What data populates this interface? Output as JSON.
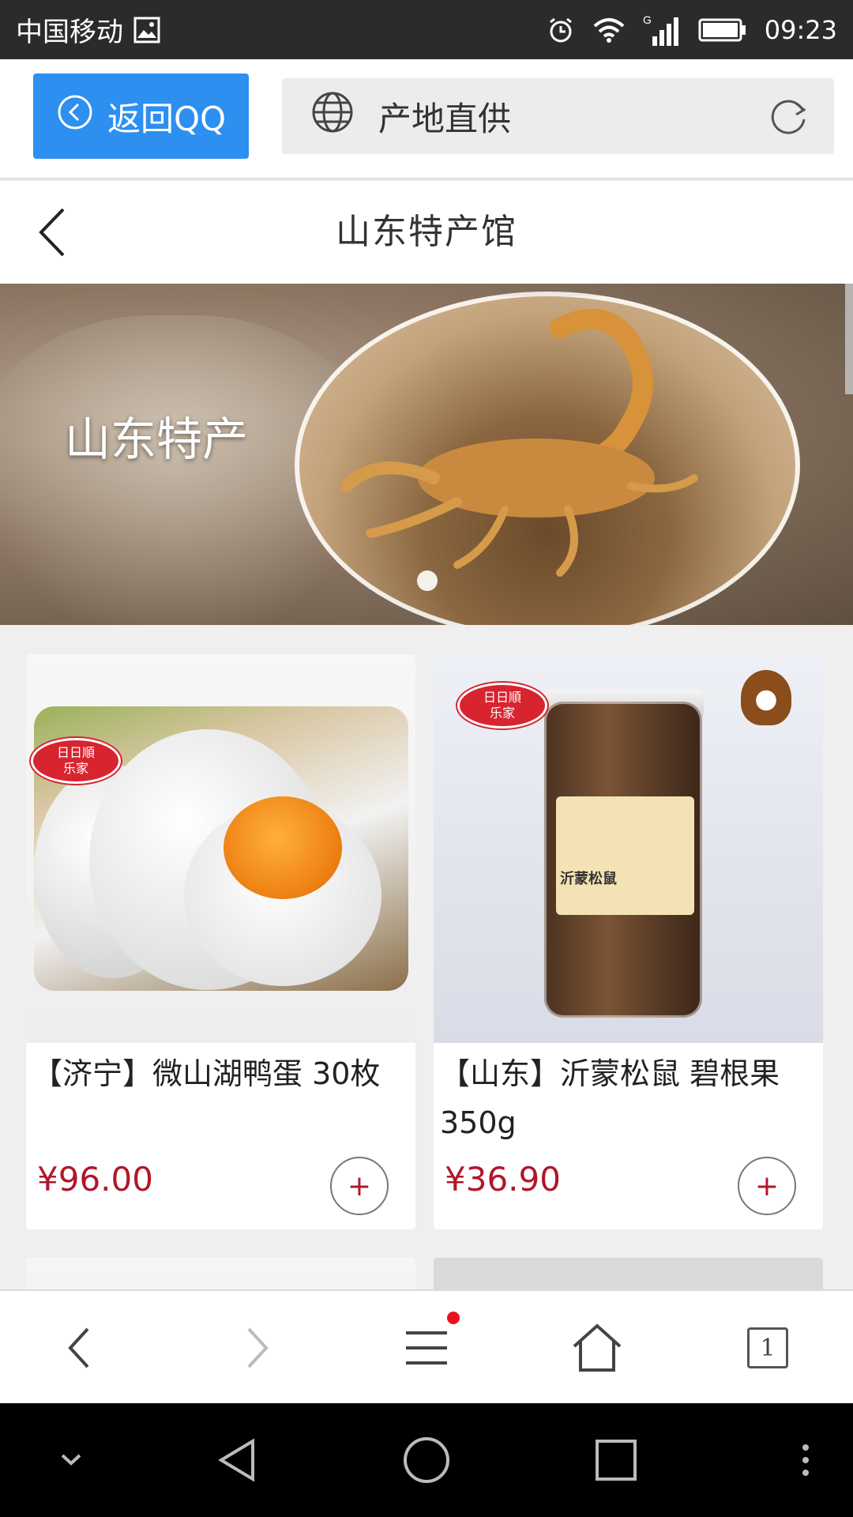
{
  "status_bar": {
    "carrier": "中国移动",
    "time": "09:23",
    "icons": [
      "gallery-icon",
      "alarm-icon",
      "wifi-icon",
      "signal-icon",
      "battery-icon"
    ],
    "network_type": "G"
  },
  "browser": {
    "back_button_label": "返回QQ",
    "address_text": "产地直供",
    "address_icon": "globe-icon",
    "refresh_icon": "refresh-icon"
  },
  "header": {
    "title": "山东特产馆",
    "back_icon": "chevron-left-icon"
  },
  "banner": {
    "text": "山东特产",
    "slide_count_visible": 1
  },
  "products": [
    {
      "name": "【济宁】微山湖鸭蛋 30枚",
      "price": "¥96.00",
      "add_label": "+",
      "badge_line1": "日日順",
      "badge_line2": "乐家"
    },
    {
      "name": "【山东】沂蒙松鼠 碧根果350g",
      "price": "¥36.90",
      "add_label": "+",
      "badge_line1": "日日順",
      "badge_line2": "乐家",
      "jar_label": "沂蒙松鼠"
    }
  ],
  "toolbar": {
    "back_icon": "arrow-left-icon",
    "forward_icon": "arrow-right-icon",
    "menu_icon": "menu-icon",
    "home_icon": "home-icon",
    "tabs_count": "1",
    "accent_color": "#e7131f"
  },
  "nav_bar": {
    "icons": [
      "collapse-icon",
      "back-triangle-icon",
      "home-circle-icon",
      "recents-square-icon",
      "more-dots-icon"
    ]
  },
  "colors": {
    "primary_blue": "#2d8ff0",
    "price_red": "#b0172a",
    "status_bar": "#2b2b2b"
  }
}
